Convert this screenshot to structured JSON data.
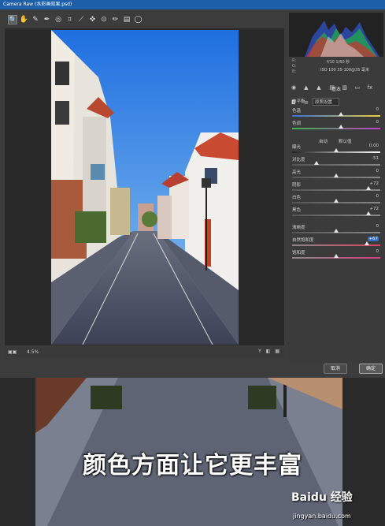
{
  "window": {
    "title": "Camera Raw (水彩画效果.psd)"
  },
  "toolbar": {
    "tools": [
      {
        "name": "zoom-tool-icon",
        "glyph": "🔍",
        "active": true
      },
      {
        "name": "hand-tool-icon",
        "glyph": "✋",
        "active": false
      },
      {
        "name": "white-balance-tool-icon",
        "glyph": "✎",
        "active": false
      },
      {
        "name": "color-sampler-tool-icon",
        "glyph": "✒",
        "active": false
      },
      {
        "name": "targeted-adjustment-tool-icon",
        "glyph": "◎",
        "active": false
      },
      {
        "name": "crop-tool-icon",
        "glyph": "⌗",
        "active": false
      },
      {
        "name": "straighten-tool-icon",
        "glyph": "⟋",
        "active": false
      },
      {
        "name": "spot-removal-tool-icon",
        "glyph": "✜",
        "active": false
      },
      {
        "name": "red-eye-tool-icon",
        "glyph": "⊙",
        "active": false
      },
      {
        "name": "adjustment-brush-icon",
        "glyph": "✏",
        "active": false
      },
      {
        "name": "graduated-filter-icon",
        "glyph": "▤",
        "active": false
      },
      {
        "name": "radial-filter-icon",
        "glyph": "◯",
        "active": false
      }
    ]
  },
  "bottombar": {
    "zoom": "4.5%"
  },
  "camera_info": {
    "line1": "f/10   1/60 秒",
    "line2": "ISO 100   35-100@35 毫米"
  },
  "panel": {
    "title": "基本",
    "wb_label": "白平衡",
    "wb_value": "原照设置",
    "auto_label": "自动",
    "default_label": "默认值",
    "sliders": [
      {
        "key": "temp",
        "label": "色温",
        "value": "0",
        "pos": 0.55,
        "track": "linear-gradient(90deg,#3a6fd8,#e8d040)"
      },
      {
        "key": "tint",
        "label": "色调",
        "value": "0",
        "pos": 0.55,
        "track": "linear-gradient(90deg,#38b84a,#c040c8)"
      },
      {
        "key": "exposure",
        "label": "曝光",
        "value": "0.00",
        "pos": 0.5,
        "track": "linear-gradient(90deg,#222,#fff)"
      },
      {
        "key": "contrast",
        "label": "对比度",
        "value": "-51",
        "pos": 0.28,
        "track": "linear-gradient(90deg,#555,#888)"
      },
      {
        "key": "highlights",
        "label": "高光",
        "value": "0",
        "pos": 0.5,
        "track": "linear-gradient(90deg,#555,#888)"
      },
      {
        "key": "shadows",
        "label": "阴影",
        "value": "+72",
        "pos": 0.87,
        "track": "linear-gradient(90deg,#555,#888)"
      },
      {
        "key": "whites",
        "label": "白色",
        "value": "0",
        "pos": 0.5,
        "track": "linear-gradient(90deg,#555,#888)"
      },
      {
        "key": "blacks",
        "label": "黑色",
        "value": "+72",
        "pos": 0.87,
        "track": "linear-gradient(90deg,#555,#888)"
      },
      {
        "key": "clarity",
        "label": "清晰度",
        "value": "0",
        "pos": 0.5,
        "track": "linear-gradient(90deg,#555,#888)"
      },
      {
        "key": "vibrance",
        "label": "自然饱和度",
        "value": "+67",
        "pos": 0.85,
        "track": "linear-gradient(90deg,#888,#e04060)",
        "highlight": true
      },
      {
        "key": "saturation",
        "label": "饱和度",
        "value": "0",
        "pos": 0.5,
        "track": "linear-gradient(90deg,#888,#d04080)"
      }
    ]
  },
  "buttons": {
    "cancel": "取消",
    "ok": "确定"
  },
  "caption": "颜色方面让它更丰富",
  "watermark": {
    "brand": "Baidu 经验",
    "url": "jingyan.baidu.com"
  },
  "colors": {
    "accent": "#2f6fc4",
    "sky": "#2f7de0"
  }
}
